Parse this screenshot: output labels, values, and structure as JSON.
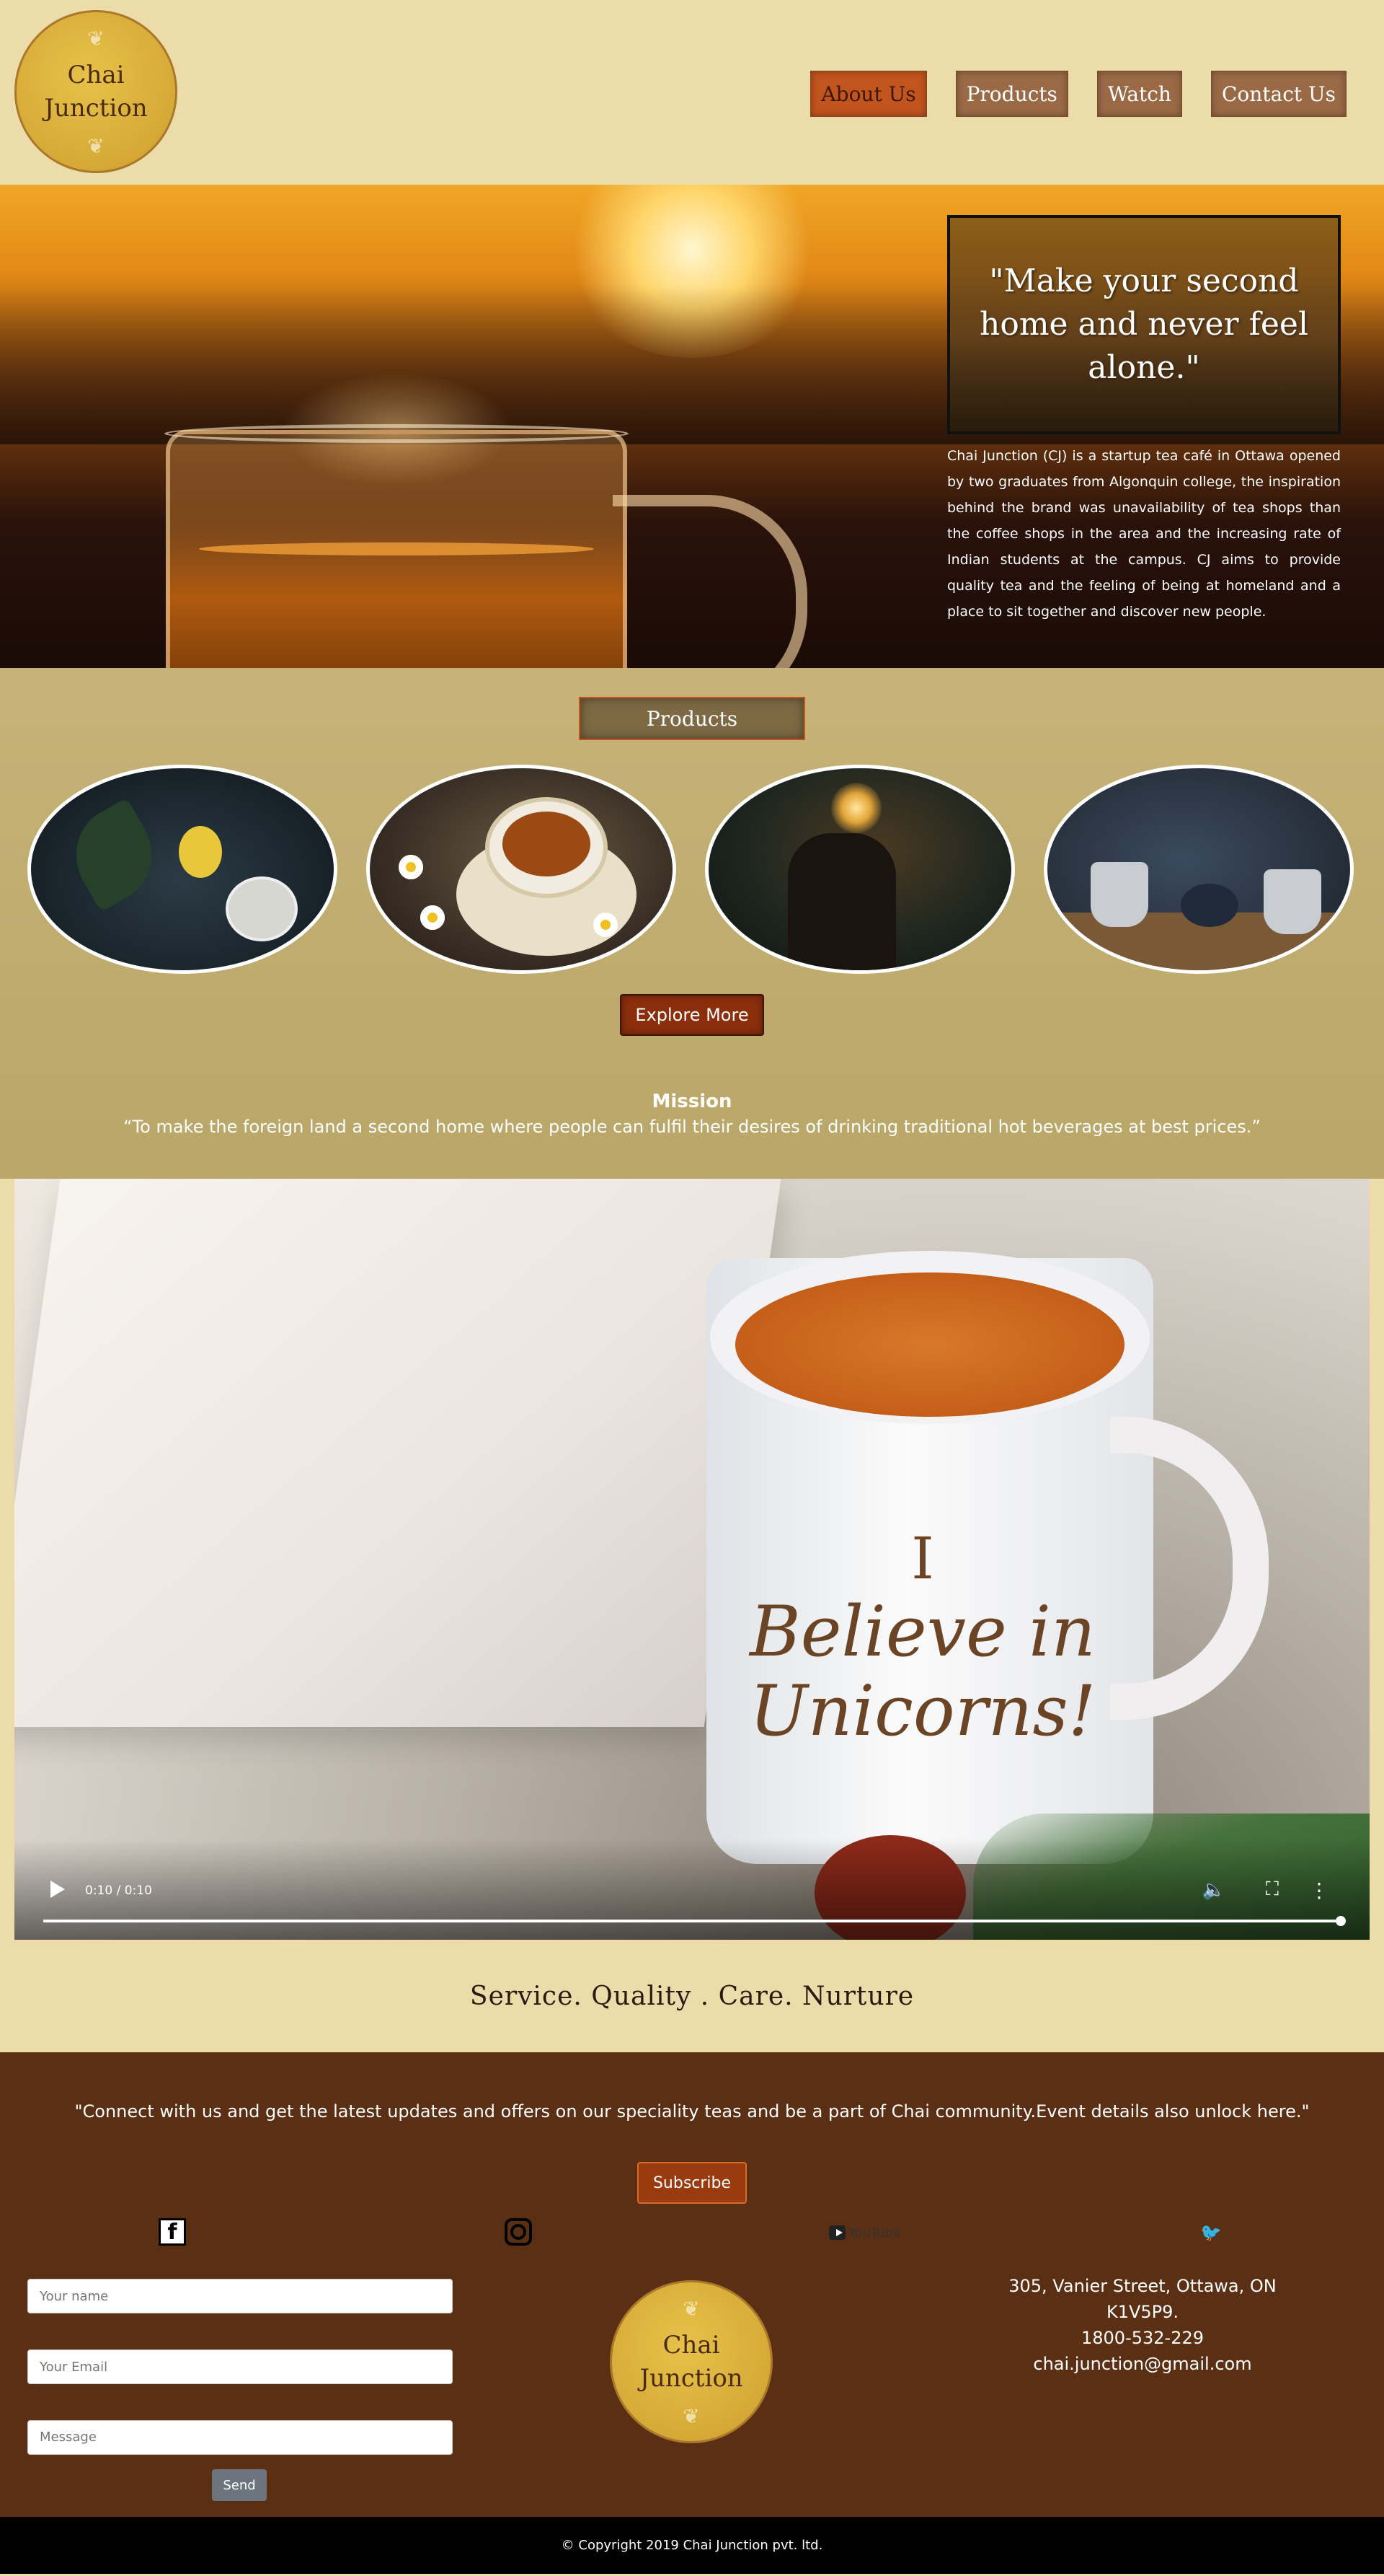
{
  "brand": {
    "logo_line1": "Chai",
    "logo_line2": "Junction"
  },
  "nav": [
    {
      "label": "About Us"
    },
    {
      "label": "Products"
    },
    {
      "label": "Watch"
    },
    {
      "label": "Contact Us"
    }
  ],
  "hero": {
    "quote": "\"Make your second home and never feel alone.\"",
    "about": "Chai Junction (CJ) is a startup tea café in Ottawa opened by two graduates from Algonquin college, the inspiration behind the brand was unavailability of tea shops than the coffee shops in the area and the increasing rate of Indian students at the campus. CJ aims to provide quality tea and the feeling of being at homeland and a place to sit together and discover new people."
  },
  "products": {
    "title": "Products",
    "explore_label": "Explore More",
    "mission_title": "Mission",
    "mission_text": "“To make the foreign land a second home where people can fulfil their desires of drinking traditional hot beverages at best prices.”"
  },
  "video": {
    "time": "0:10 / 0:10",
    "progress": 1.0,
    "mug_text_1": "I",
    "mug_text_2": "Believe in Unicorns!"
  },
  "tagline": "Service. Quality . Care. Nurture",
  "footer": {
    "connect_text": "\"Connect with us and get the latest updates and offers on our speciality teas and be a part of Chai community.Event details also unlock here.\"",
    "subscribe_label": "Subscribe",
    "youtube_label": "YouTube",
    "form": {
      "name_placeholder": "Your name",
      "email_placeholder": "Your Email",
      "message_placeholder": "Message",
      "send_label": "Send"
    },
    "address_line1": "305, Vanier Street, Ottawa, ON",
    "address_line2": "K1V5P9.",
    "phone": "1800-532-229",
    "email": "chai.junction@gmail.com"
  },
  "copyright": "© Copyright 2019 Chai Junction pvt. ltd.",
  "colors": {
    "page_bg": "#ecdcaa",
    "nav_active": "#c2541e",
    "footer_bg": "#5a2f13",
    "button_dark": "#8b2e0c"
  },
  "icons": [
    "facebook-icon",
    "instagram-icon",
    "youtube-icon",
    "twitter-icon",
    "play-icon",
    "volume-icon",
    "fullscreen-icon",
    "more-options-icon"
  ]
}
